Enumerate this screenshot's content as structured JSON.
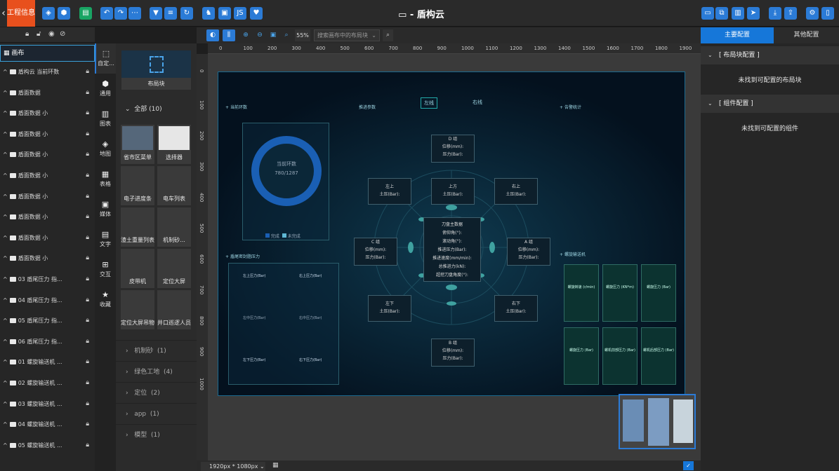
{
  "app": {
    "brand": "工程信息",
    "title": "盾构云",
    "title_icon": "window-icon"
  },
  "toolbar": {
    "icons": [
      "layers-icon",
      "box-icon",
      "file-icon",
      "undo-icon",
      "redo-icon",
      "more-icon",
      "filter-icon",
      "database-icon",
      "refresh-icon",
      "shirt-icon",
      "save-icon",
      "js-icon",
      "heart-icon"
    ],
    "js_label": "JS"
  },
  "toolbar_right": {
    "icons": [
      "monitor-icon",
      "copy-icon",
      "document-icon",
      "send-icon",
      "download-icon",
      "export-icon",
      "settings-icon",
      "sidebar-icon"
    ]
  },
  "layers": {
    "canvas_label": "画布",
    "items": [
      "盾构云 当前环数",
      "盾面数据",
      "盾面数据 小",
      "盾面数据 小",
      "盾面数据 小",
      "盾面数据 小",
      "盾面数据 小",
      "盾面数据 小",
      "盾面数据 小",
      "盾面数据 小",
      "03 盾尾压力 指...",
      "04 盾尾压力 指...",
      "05 盾尾压力 指...",
      "06 盾尾压力 指...",
      "01 螺旋输送机 ...",
      "02 螺旋输送机 ...",
      "03 螺旋输送机 ...",
      "04 螺旋输送机 ...",
      "05 螺旋输送机 ..."
    ]
  },
  "categories": [
    {
      "label": "自定...",
      "icon": "custom-icon"
    },
    {
      "label": "通用",
      "icon": "cube-icon"
    },
    {
      "label": "图表",
      "icon": "chart-icon"
    },
    {
      "label": "地图",
      "icon": "map-icon"
    },
    {
      "label": "表格",
      "icon": "table-icon"
    },
    {
      "label": "媒体",
      "icon": "media-icon"
    },
    {
      "label": "文字",
      "icon": "text-icon"
    },
    {
      "label": "交互",
      "icon": "interaction-icon"
    },
    {
      "label": "收藏",
      "icon": "star-icon"
    }
  ],
  "components": {
    "layout_block": "布局块",
    "all_label": "全部",
    "all_count": "(10)",
    "tiles": [
      "省市区菜单",
      "选择器",
      "电子进度条",
      "电车列表",
      "渣土重量列表",
      "机制砂...",
      "皮带机",
      "定位大屏",
      "定位大屏吊物",
      "井口巡逻人员"
    ],
    "groups": [
      {
        "name": "机制砂",
        "count": "(1)"
      },
      {
        "name": "绿色工地",
        "count": "(4)"
      },
      {
        "name": "定位",
        "count": "(2)"
      },
      {
        "name": "app",
        "count": "(1)"
      },
      {
        "name": "模型",
        "count": "(1)"
      }
    ]
  },
  "canvas_toolbar": {
    "zoom": "55%",
    "search_placeholder": "搜索画布中的布局块"
  },
  "ruler": {
    "h_ticks": [
      "0",
      "100",
      "200",
      "300",
      "400",
      "500",
      "600",
      "700",
      "800",
      "900",
      "1000",
      "1100",
      "1200",
      "1300",
      "1400",
      "1500",
      "1600",
      "1700",
      "1800",
      "1900"
    ],
    "v_ticks": [
      "0",
      "100",
      "200",
      "300",
      "400",
      "500",
      "600",
      "700",
      "800",
      "900",
      "1000"
    ]
  },
  "screen": {
    "panel_left_top": "当前环数",
    "panel_top_center": "推进参数",
    "left_line": "左线",
    "right_line": "右线",
    "panel_right_top": "告警统计",
    "dial_title": "当前环数",
    "dial_value": "780/1287",
    "legend_done": "完成",
    "legend_todo": "未完成",
    "panel_left_bottom": "盾尾密封脂压力",
    "tail": [
      "左上压力(Bar)",
      "右上压力(Bar)",
      "左中压力(Bar)",
      "右中压力(Bar)",
      "左下压力(Bar)",
      "右下压力(Bar)"
    ],
    "zone_D": [
      "D 组",
      "位移(mm):",
      "压力(Bar):"
    ],
    "zone_B": [
      "B 组",
      "位移(mm):",
      "压力(Bar):"
    ],
    "zone_C": [
      "C 组",
      "位移(mm):",
      "压力(Bar):"
    ],
    "zone_A": [
      "A 组",
      "位移(mm):",
      "压力(Bar):"
    ],
    "small": [
      {
        "t": "左上",
        "v": "土压(Bar):"
      },
      {
        "t": "上方",
        "v": "土压(Bar):"
      },
      {
        "t": "右上",
        "v": "土压(Bar):"
      },
      {
        "t": "左下",
        "v": "土压(Bar):"
      },
      {
        "t": "右下",
        "v": "土压(Bar):"
      }
    ],
    "center": [
      "刀盘主数据",
      "俯仰角(°):",
      "滚动角(°):",
      "推进压力(Bar):",
      "推进速度(mm/min):",
      "总推进力(kN):",
      "超挖刀盘角度(°):"
    ],
    "panel_right_bottom": "螺旋输送机",
    "screw": [
      "螺旋转速 (r/min)",
      "螺旋压力 (KN*m)",
      "螺旋压力 (Bar)",
      "螺旋压力 (Bar)",
      "螺机前部压力 (Bar)",
      "螺机后部压力 (Bar)"
    ]
  },
  "status": {
    "resolution": "1920px * 1080px"
  },
  "right_panel": {
    "tab_main": "主要配置",
    "tab_other": "其他配置",
    "section_layout": "[ 布局块配置 ]",
    "section_layout_msg": "未找到可配置的布局块",
    "section_comp": "[ 组件配置 ]",
    "section_comp_msg": "未找到可配置的组件"
  }
}
